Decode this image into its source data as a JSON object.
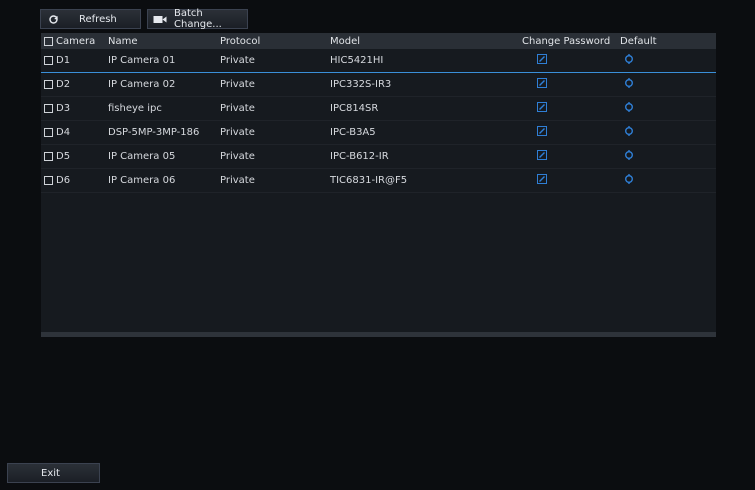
{
  "toolbar": {
    "refresh_label": "Refresh",
    "batch_label": "Batch Change..."
  },
  "table": {
    "columns": [
      "Camera",
      "Name",
      "Protocol",
      "Model",
      "Change Password",
      "Default"
    ],
    "rows": [
      {
        "camera": "D1",
        "name": "IP Camera 01",
        "protocol": "Private",
        "model": "HIC5421HI"
      },
      {
        "camera": "D2",
        "name": "IP Camera 02",
        "protocol": "Private",
        "model": "IPC332S-IR3"
      },
      {
        "camera": "D3",
        "name": "fisheye  ipc",
        "protocol": "Private",
        "model": "IPC814SR"
      },
      {
        "camera": "D4",
        "name": "DSP-5MP-3MP-186",
        "protocol": "Private",
        "model": "IPC-B3A5"
      },
      {
        "camera": "D5",
        "name": "IP Camera 05",
        "protocol": "Private",
        "model": "IPC-B612-IR"
      },
      {
        "camera": "D6",
        "name": "IP Camera 06",
        "protocol": "Private",
        "model": "TIC6831-IR@F5"
      }
    ]
  },
  "footer": {
    "exit_label": "Exit"
  },
  "colors": {
    "accent": "#3a8fd8",
    "icon_blue": "#2f7fd6"
  },
  "icons": {
    "refresh": "refresh-icon",
    "batch": "camera-icon",
    "edit": "edit-icon",
    "default": "default-reset-icon"
  }
}
